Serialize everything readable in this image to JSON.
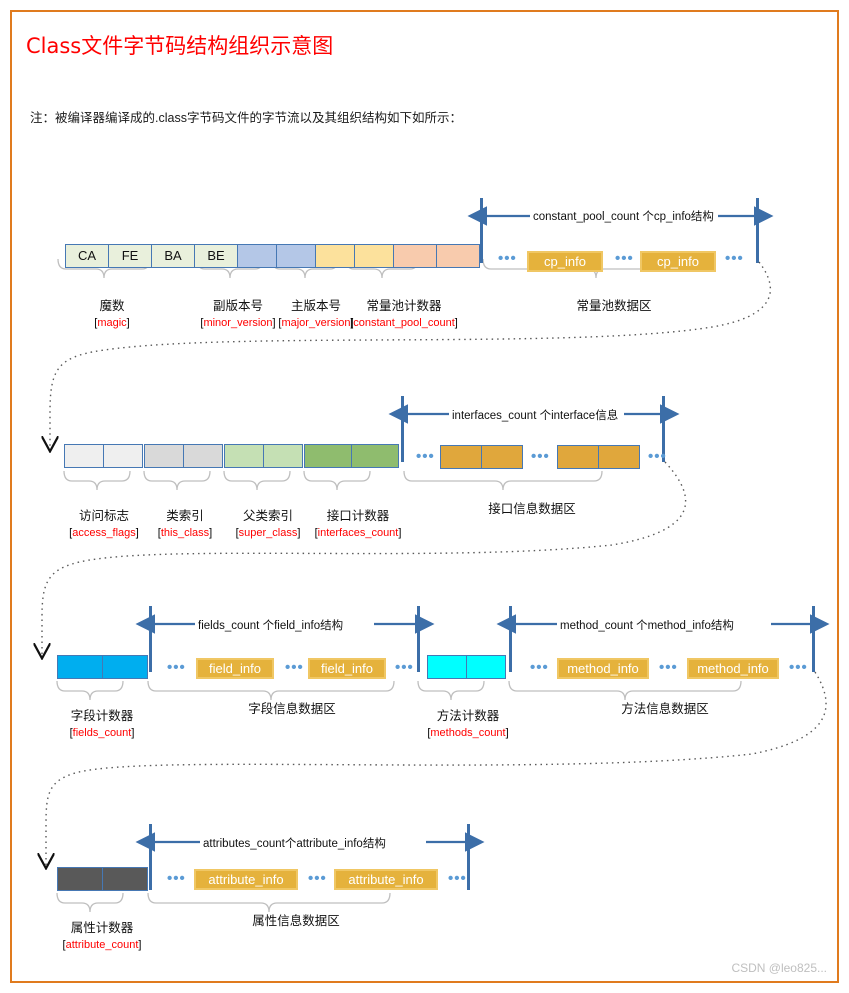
{
  "document": {
    "title": "Class文件字节码结构组织示意图",
    "note": "注：被编译器编译成的.class字节码文件的字节流以及其组织结构如下如所示：",
    "watermark": "CSDN @leo825...",
    "border_color": "#E07B1E",
    "title_color": "#FF0000"
  },
  "rows": [
    {
      "id": "row1",
      "groups": [
        {
          "cn": "魔数",
          "en": "magic",
          "cells": [
            "CA",
            "FE",
            "BA",
            "BE"
          ],
          "color": "#E9F0DC"
        },
        {
          "cn": "副版本号",
          "en": "minor_version",
          "cells": [
            "",
            ""
          ],
          "color": "#B4C7E7"
        },
        {
          "cn": "主版本号",
          "en": "major_version",
          "cells": [
            "",
            ""
          ],
          "color": "#FCE19C"
        },
        {
          "cn": "常量池计数器",
          "en": "constant_pool_count",
          "cells": [
            "",
            ""
          ],
          "color": "#F8CBAD"
        }
      ],
      "region": {
        "measure": "constant_pool_count 个cp_info结构",
        "label": "常量池数据区",
        "items": [
          "cp_info",
          "cp_info"
        ],
        "style": "box"
      }
    },
    {
      "id": "row2",
      "groups": [
        {
          "cn": "访问标志",
          "en": "access_flags",
          "cells": [
            "",
            ""
          ],
          "color": "#EFEFEF"
        },
        {
          "cn": "类索引",
          "en": "this_class",
          "cells": [
            "",
            ""
          ],
          "color": "#D9D9D9"
        },
        {
          "cn": "父类索引",
          "en": "super_class",
          "cells": [
            "",
            ""
          ],
          "color": "#C5E0B4"
        },
        {
          "cn": "接口计数器",
          "en": "interfaces_count",
          "cells": [
            "",
            ""
          ],
          "color": "#8FBC6E"
        }
      ],
      "region": {
        "measure": "interfaces_count 个interface信息",
        "label": "接口信息数据区",
        "items": [
          "",
          ""
        ],
        "style": "cells",
        "item_color": "#E0A73C"
      }
    },
    {
      "id": "row3",
      "groups": [
        {
          "cn": "字段计数器",
          "en": "fields_count",
          "cells": [
            "",
            ""
          ],
          "color": "#00AEEF"
        }
      ],
      "region": {
        "measure": "fields_count 个field_info结构",
        "label": "字段信息数据区",
        "items": [
          "field_info",
          "field_info"
        ],
        "style": "box"
      },
      "groups2": [
        {
          "cn": "方法计数器",
          "en": "methods_count",
          "cells": [
            "",
            ""
          ],
          "color": "#00FFFF"
        }
      ],
      "region2": {
        "measure": "method_count 个method_info结构",
        "label": "方法信息数据区",
        "items": [
          "method_info",
          "method_info"
        ],
        "style": "box"
      }
    },
    {
      "id": "row4",
      "groups": [
        {
          "cn": "属性计数器",
          "en": "attribute_count",
          "cells": [
            "",
            ""
          ],
          "color": "#595959"
        }
      ],
      "region": {
        "measure": "attributes_count个attribute_info结构",
        "label": "属性信息数据区",
        "items": [
          "attribute_info",
          "attribute_info"
        ],
        "style": "box"
      }
    }
  ],
  "labels": {
    "row1": {
      "g0_cn": "魔数",
      "g0_en": "magic",
      "g1_cn": "副版本号",
      "g1_en": "minor_version",
      "g2_cn": "主版本号",
      "g2_en": "major_version",
      "g3_cn": "常量池计数器",
      "g3_en": "constant_pool_count",
      "region_cn": "常量池数据区",
      "region_measure": "constant_pool_count 个cp_info结构",
      "item0": "cp_info",
      "item1": "cp_info",
      "b0": "CA",
      "b1": "FE",
      "b2": "BA",
      "b3": "BE"
    },
    "row2": {
      "g0_cn": "访问标志",
      "g0_en": "access_flags",
      "g1_cn": "类索引",
      "g1_en": "this_class",
      "g2_cn": "父类索引",
      "g2_en": "super_class",
      "g3_cn": "接口计数器",
      "g3_en": "interfaces_count",
      "region_cn": "接口信息数据区",
      "region_measure": "interfaces_count 个interface信息"
    },
    "row3": {
      "g0_cn": "字段计数器",
      "g0_en": "fields_count",
      "region_cn": "字段信息数据区",
      "region_measure": "fields_count 个field_info结构",
      "item0": "field_info",
      "item1": "field_info",
      "g1_cn": "方法计数器",
      "g1_en": "methods_count",
      "region2_cn": "方法信息数据区",
      "region2_measure": "method_count 个method_info结构",
      "item2": "method_info",
      "item3": "method_info"
    },
    "row4": {
      "g0_cn": "属性计数器",
      "g0_en": "attribute_count",
      "region_cn": "属性信息数据区",
      "region_measure": "attributes_count个attribute_info结构",
      "item0": "attribute_info",
      "item1": "attribute_info"
    }
  },
  "ellipsis": "•••"
}
